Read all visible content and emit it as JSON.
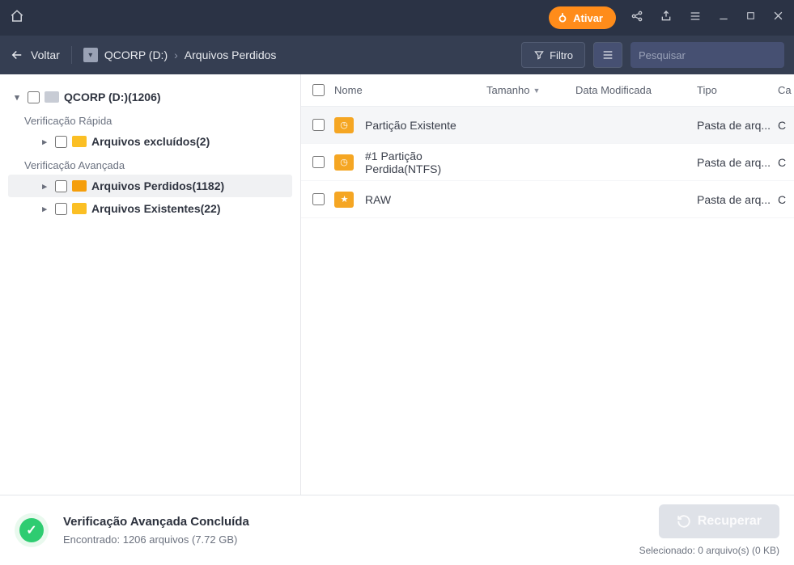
{
  "titlebar": {
    "activate_label": "Ativar"
  },
  "toolbar": {
    "back_label": "Voltar",
    "crumb_drive": "QCORP (D:)",
    "crumb_section": "Arquivos Perdidos",
    "filter_label": "Filtro",
    "search_placeholder": "Pesquisar"
  },
  "sidebar": {
    "root_label": "QCORP (D:)(1206)",
    "quick_label": "Verificação Rápida",
    "quick_items": [
      {
        "label": "Arquivos excluídos(2)"
      }
    ],
    "adv_label": "Verificação Avançada",
    "adv_items": [
      {
        "label": "Arquivos Perdidos(1182)",
        "selected": true
      },
      {
        "label": "Arquivos Existentes(22)",
        "selected": false
      }
    ]
  },
  "columns": {
    "name": "Nome",
    "size": "Tamanho",
    "date": "Data Modificada",
    "type": "Tipo",
    "path": "Ca"
  },
  "rows": [
    {
      "name": "Partição Existente",
      "type": "Pasta de arq...",
      "path": "C",
      "thumb": "ft-recycle",
      "hovered": true
    },
    {
      "name": "#1 Partição Perdida(NTFS)",
      "type": "Pasta de arq...",
      "path": "C",
      "thumb": "ft-lost",
      "hovered": false
    },
    {
      "name": "RAW",
      "type": "Pasta de arq...",
      "path": "C",
      "thumb": "ft-star",
      "hovered": false
    }
  ],
  "status": {
    "title": "Verificação Avançada Concluída",
    "subtitle": "Encontrado: 1206 arquivos (7.72 GB)",
    "recover_label": "Recuperar",
    "selected_label": "Selecionado: 0 arquivo(s) (0 KB)"
  }
}
